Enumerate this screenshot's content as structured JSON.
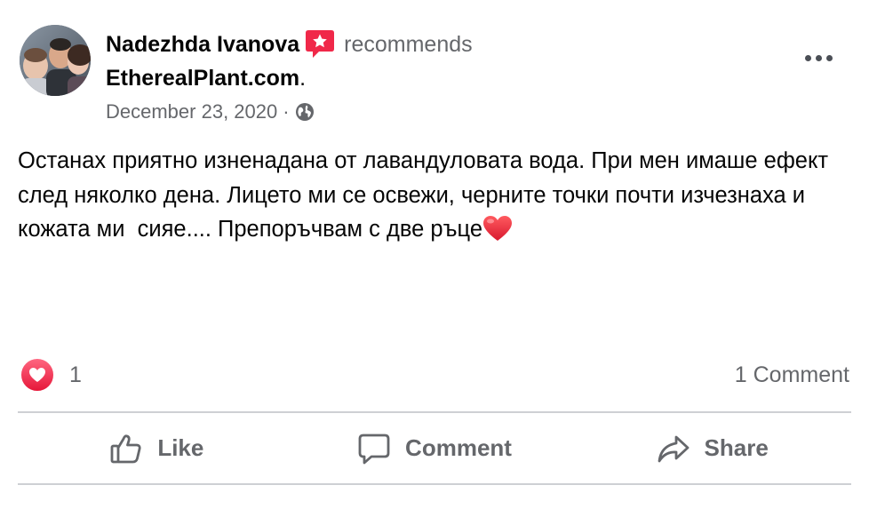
{
  "post": {
    "author": "Nadezhda Ivanova",
    "action_text": "recommends",
    "page_name": "EtherealPlant.com",
    "page_suffix": ".",
    "date": "December 23, 2020",
    "date_separator": "·",
    "privacy_icon": "globe-icon",
    "body_text": "Останах приятно изненадана от лавандуловата вода. При мен имаше ефект след няколко дена. Лицето ми се освежи, черните точки почти изчезнаха и кожата ми  сияе.... Препоръчвам с две ръце",
    "body_emoji": "red-heart-emoji"
  },
  "stats": {
    "reaction_icon": "love-reaction-icon",
    "reaction_count": "1",
    "comment_count_label": "1 Comment"
  },
  "actions": {
    "like_label": "Like",
    "comment_label": "Comment",
    "share_label": "Share"
  },
  "colors": {
    "primary_text": "#050505",
    "secondary_text": "#65676b",
    "divider": "#ced0d4",
    "love_red": "#f33e58",
    "recommend_badge": "#f02849"
  }
}
